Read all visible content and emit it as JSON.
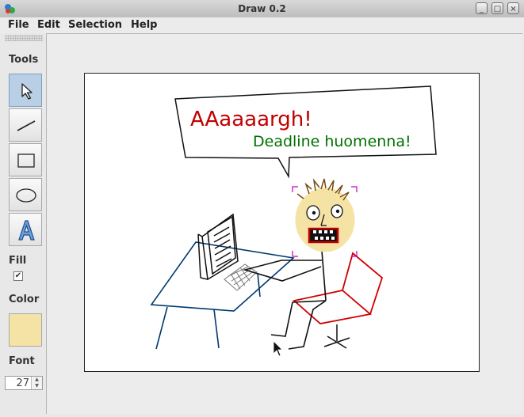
{
  "window": {
    "title": "Draw 0.2",
    "buttons": [
      "minimize",
      "maximize",
      "close"
    ]
  },
  "menu": [
    "File",
    "Edit",
    "Selection",
    "Help"
  ],
  "sidebar": {
    "tools_label": "Tools",
    "tools": [
      {
        "name": "select",
        "icon": "arrow-pointer-icon",
        "active": true
      },
      {
        "name": "line",
        "icon": "line-icon",
        "active": false
      },
      {
        "name": "rectangle",
        "icon": "rectangle-icon",
        "active": false
      },
      {
        "name": "ellipse",
        "icon": "ellipse-icon",
        "active": false
      },
      {
        "name": "text",
        "icon": "text-a-icon",
        "active": false
      }
    ],
    "fill_label": "Fill",
    "fill_checked": true,
    "color_label": "Color",
    "color_value": "#f5e3a6",
    "font_label": "Font",
    "font_size": "27"
  },
  "drawing": {
    "speech_big": "AAaaaargh!",
    "speech_small": "Deadline huomenna!",
    "colors": {
      "big_text": "#c00000",
      "small_text": "#007000",
      "face": "#f5e3a6",
      "desk": "#003a70",
      "chair": "#d00000",
      "selection": "#c000c0"
    }
  }
}
